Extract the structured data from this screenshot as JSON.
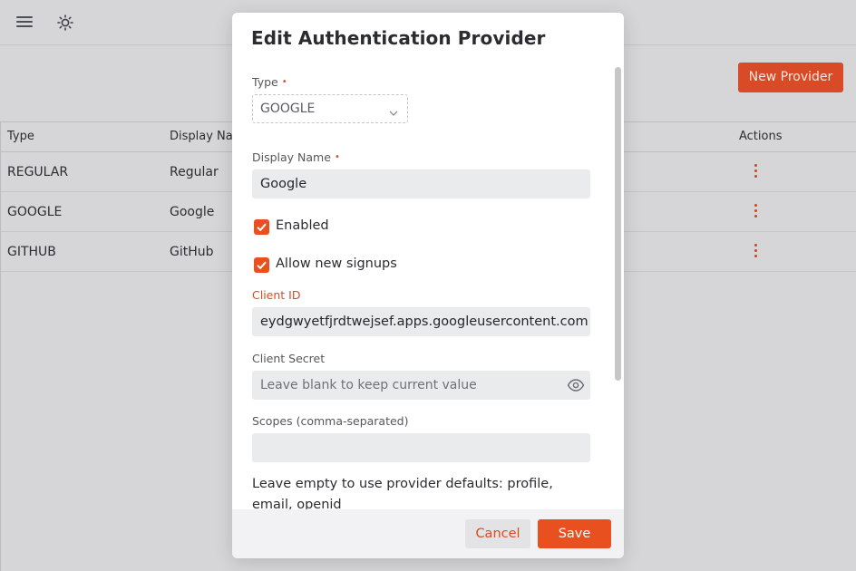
{
  "topbar": {
    "menu_icon": "hamburger-menu-icon",
    "theme_icon": "sun-icon"
  },
  "page": {
    "new_provider_label": "New Provider"
  },
  "table": {
    "headers": [
      "Type",
      "Display Nam",
      "Actions"
    ],
    "rows": [
      {
        "type": "REGULAR",
        "display_name": "Regular"
      },
      {
        "type": "GOOGLE",
        "display_name": "Google"
      },
      {
        "type": "GITHUB",
        "display_name": "GitHub"
      }
    ]
  },
  "modal": {
    "title": "Edit Authentication Provider",
    "type_label": "Type",
    "type_value": "GOOGLE",
    "display_name_label": "Display Name",
    "display_name_value": "Google",
    "required_mark": "•",
    "enabled_label": "Enabled",
    "enabled_checked": true,
    "allow_signups_label": "Allow new signups",
    "allow_signups_checked": true,
    "client_id_label": "Client ID",
    "client_id_value": "eydgwyetfjrdtwejsef.apps.googleusercontent.com",
    "client_secret_label": "Client Secret",
    "client_secret_placeholder": "Leave blank to keep current value",
    "scopes_label": "Scopes (comma-separated)",
    "scopes_value": "",
    "help_text": "Leave empty to use provider defaults: profile, email, openid",
    "cancel_label": "Cancel",
    "save_label": "Save"
  },
  "colors": {
    "accent": "#e9501f",
    "accent_dark": "#d94b26",
    "input_bg": "#eaebed",
    "overlay_bg": "#d6d6d8"
  }
}
